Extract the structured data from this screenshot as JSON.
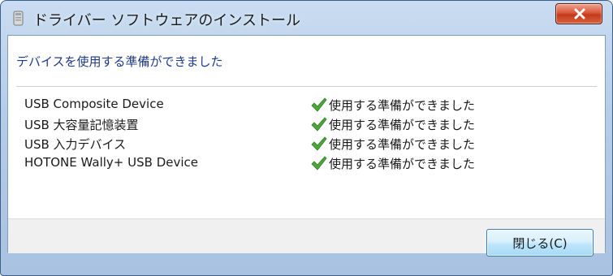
{
  "window": {
    "title": "ドライバー ソフトウェアのインストール",
    "close_icon": "close-x"
  },
  "main": {
    "heading": "デバイスを使用する準備ができました",
    "devices": [
      {
        "name": "USB Composite Device",
        "status": "使用する準備ができました",
        "status_icon": "check-icon"
      },
      {
        "name": "USB 大容量記憶装置",
        "status": "使用する準備ができました",
        "status_icon": "check-icon"
      },
      {
        "name": "USB 入力デバイス",
        "status": "使用する準備ができました",
        "status_icon": "check-icon"
      },
      {
        "name": "HOTONE Wally+ USB Device",
        "status": "使用する準備ができました",
        "status_icon": "check-icon"
      }
    ]
  },
  "footer": {
    "close_label": "閉じる(C)"
  },
  "colors": {
    "heading": "#1e3a8a",
    "check": "#4aa83a",
    "title_close": "#c4391c"
  }
}
